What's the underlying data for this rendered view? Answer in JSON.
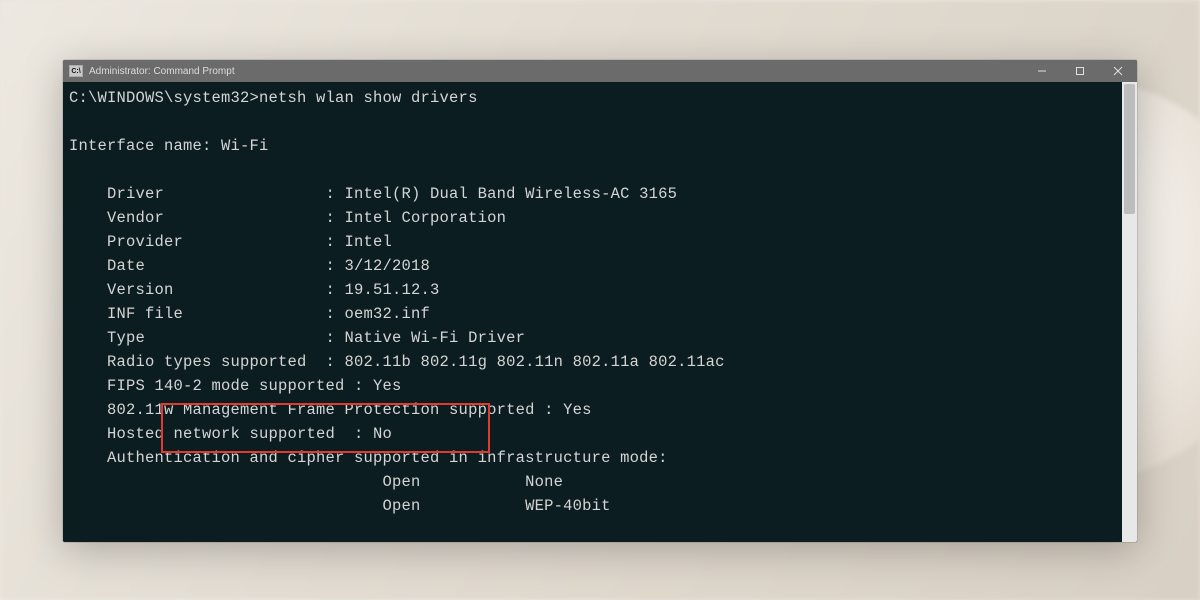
{
  "window": {
    "title": "Administrator: Command Prompt",
    "icon_label": "C:\\"
  },
  "prompt": {
    "path": "C:\\WINDOWS\\system32>",
    "command": "netsh wlan show drivers"
  },
  "output": {
    "interface_line": "Interface name: Wi-Fi",
    "rows": [
      {
        "label": "Driver",
        "value": "Intel(R) Dual Band Wireless-AC 3165"
      },
      {
        "label": "Vendor",
        "value": "Intel Corporation"
      },
      {
        "label": "Provider",
        "value": "Intel"
      },
      {
        "label": "Date",
        "value": "3/12/2018"
      },
      {
        "label": "Version",
        "value": "19.51.12.3"
      },
      {
        "label": "INF file",
        "value": "oem32.inf"
      },
      {
        "label": "Type",
        "value": "Native Wi-Fi Driver"
      },
      {
        "label": "Radio types supported",
        "value": "802.11b 802.11g 802.11n 802.11a 802.11ac"
      },
      {
        "label": "FIPS 140-2 mode supported",
        "value": "Yes"
      },
      {
        "label": "802.11w Management Frame Protection supported",
        "value": "Yes"
      },
      {
        "label": "Hosted network supported",
        "value": "No"
      },
      {
        "label": "Authentication and cipher supported in infrastructure mode:",
        "value": ""
      }
    ],
    "cipher_rows": [
      {
        "auth": "Open",
        "cipher": "None"
      },
      {
        "auth": "Open",
        "cipher": "WEP-40bit"
      }
    ]
  },
  "highlight": {
    "target_label": "Hosted network supported",
    "target_value": "No"
  }
}
